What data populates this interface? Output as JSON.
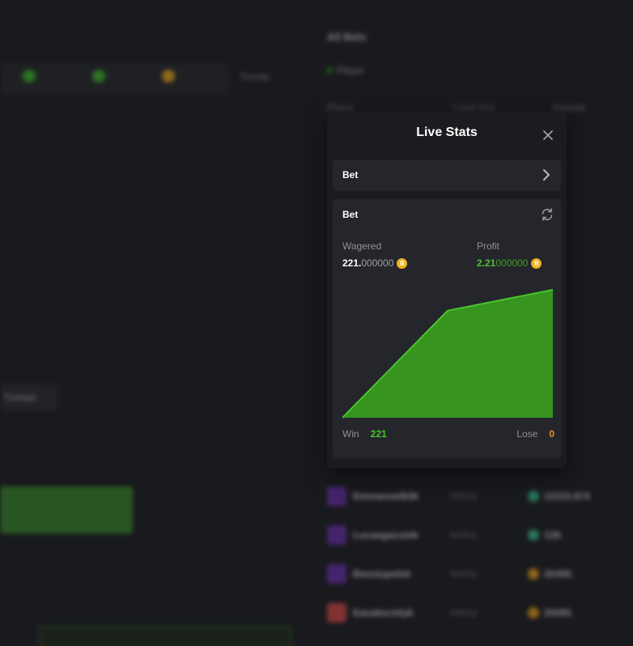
{
  "background": {
    "all_bets_title": "All Bets",
    "players_label": "Player",
    "trends_label": "Trends",
    "trend_tab_label": "Trenlad",
    "column_headers": [
      "Player",
      "Cash Out",
      "Amount"
    ],
    "rows": [
      {
        "name": "Emmanuel636",
        "status": "betting",
        "value": "12315.874",
        "coin_color": "#3dbf8f"
      },
      {
        "name": "Lucasgacomb",
        "status": "betting",
        "value": "128.",
        "coin_color": "#3dbf8f"
      },
      {
        "name": "Bensiupeleb",
        "status": "betting",
        "value": "20495.",
        "coin_color": "#f2a21f"
      },
      {
        "name": "Eanaberstiyk",
        "status": "betting",
        "value": "20085.",
        "coin_color": "#f2a21f"
      }
    ]
  },
  "modal": {
    "title": "Live Stats",
    "close_icon": "close-icon",
    "selector_label": "Bet",
    "card_title": "Bet",
    "wagered": {
      "label": "Wagered",
      "strong": "221.",
      "dim": "000000",
      "coin": "B"
    },
    "profit": {
      "label": "Profit",
      "strong": "2.21",
      "dim": "000000",
      "coin": "B"
    },
    "win_label": "Win",
    "win_count": "221",
    "lose_label": "Lose",
    "lose_count": "0"
  },
  "colors": {
    "accent_green": "#49c42e",
    "chart_fill": "#36941f",
    "lose_orange": "#f08a2b",
    "coin_gold": "#f2b11f"
  },
  "chart_data": {
    "type": "area",
    "title": "",
    "xlabel": "",
    "ylabel": "",
    "x": [
      0,
      1,
      2
    ],
    "series": [
      {
        "values": [
          0,
          1.85,
          2.21
        ]
      }
    ],
    "grid": false,
    "legend": "none"
  }
}
